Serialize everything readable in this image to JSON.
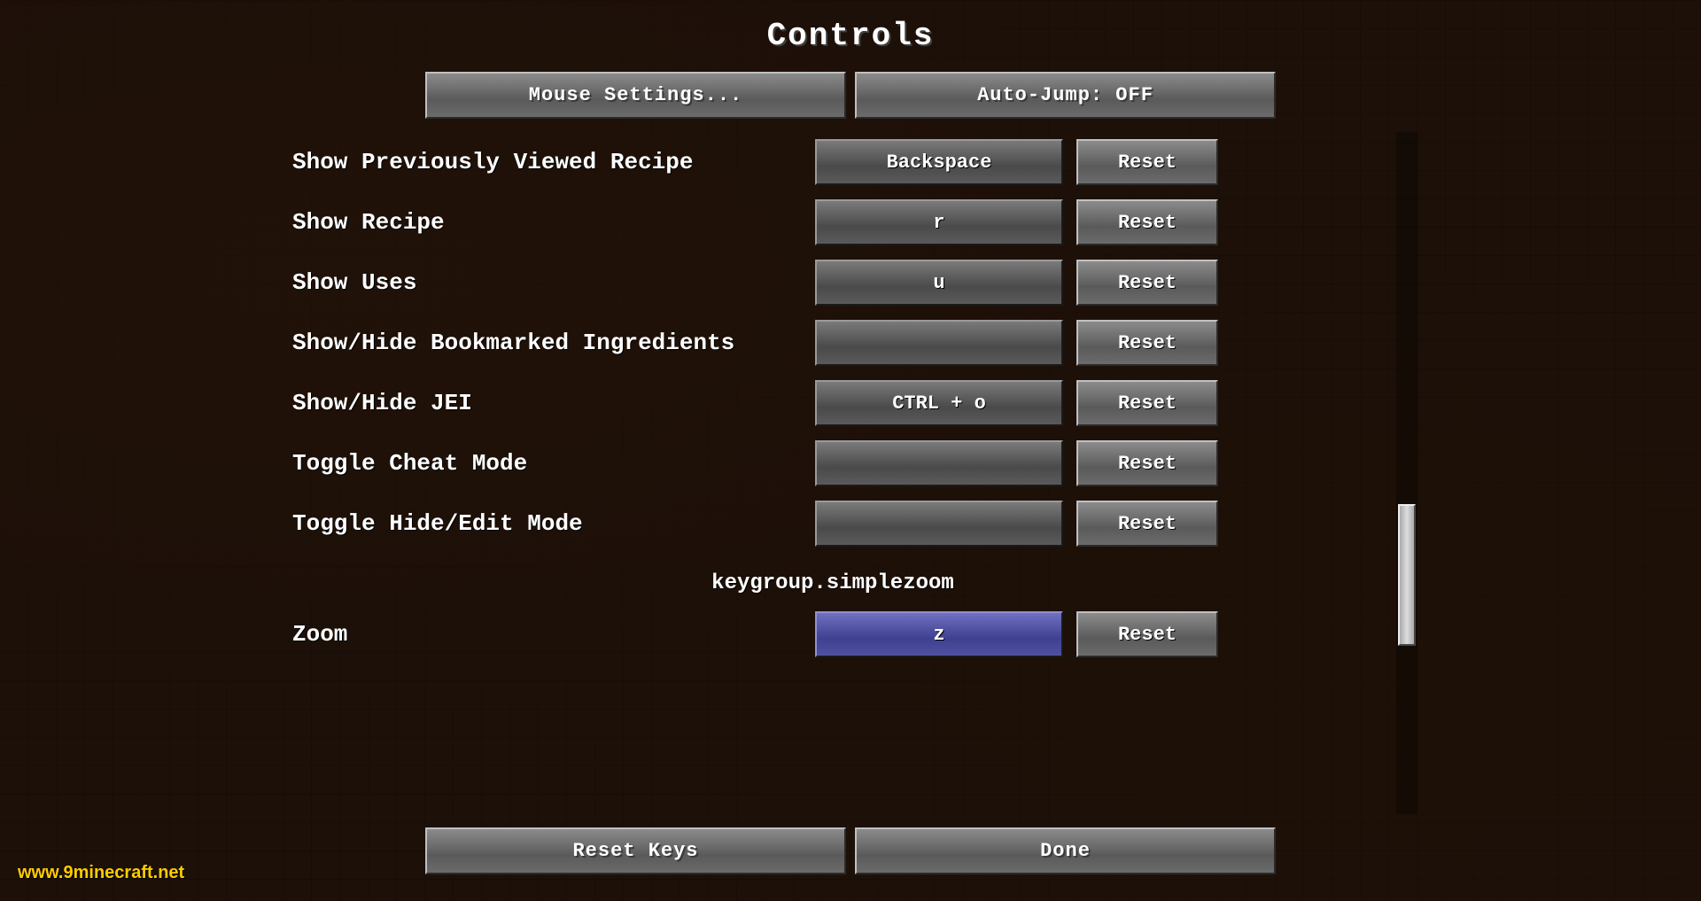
{
  "title": "Controls",
  "topButtons": {
    "mouseSettings": "Mouse Settings...",
    "autoJump": "Auto-Jump: OFF"
  },
  "keybindings": [
    {
      "label": "Show Previously Viewed Recipe",
      "key": "Backspace",
      "active": false
    },
    {
      "label": "Show Recipe",
      "key": "r",
      "active": false
    },
    {
      "label": "Show Uses",
      "key": "u",
      "active": false
    },
    {
      "label": "Show/Hide Bookmarked Ingredients",
      "key": "",
      "active": false
    },
    {
      "label": "Show/Hide JEI",
      "key": "CTRL + o",
      "active": false
    },
    {
      "label": "Toggle Cheat Mode",
      "key": "",
      "active": false
    },
    {
      "label": "Toggle Hide/Edit Mode",
      "key": "",
      "active": false
    }
  ],
  "sectionHeader": "keygroup.simplezoom",
  "zoomRow": {
    "label": "Zoom",
    "key": "z",
    "active": true
  },
  "resetLabel": "Reset",
  "bottomButtons": {
    "resetKeys": "Reset Keys",
    "done": "Done"
  },
  "watermark": {
    "prefix": "www.",
    "highlight": "9minecraft",
    "suffix": ".net"
  }
}
